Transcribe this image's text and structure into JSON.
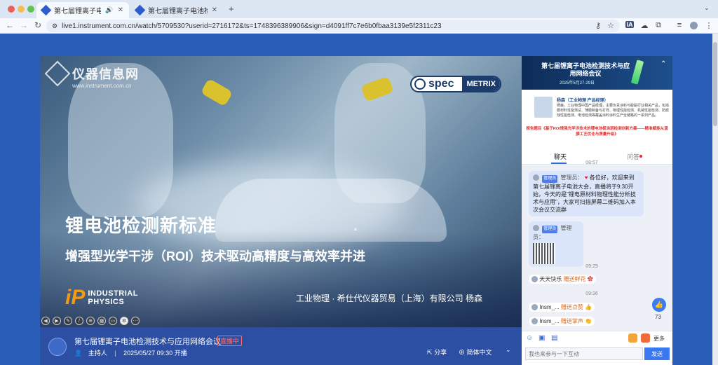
{
  "browser": {
    "tabs": [
      {
        "title": "第七届锂离子电池检测技术"
      },
      {
        "title": "第七届锂离子电池检测技术与应"
      }
    ],
    "new_tab": "+",
    "url": "live1.instrument.com.cn/watch/5709530?userid=2716172&ts=1748396389906&sign=d4091ff7c7e6b0fbaa3139e5f2311c23"
  },
  "slide": {
    "brand_logo": "仪器信息网",
    "brand_url": "www.instrument.com.cn",
    "spec_logo": {
      "left": "spec",
      "right": "METRIX"
    },
    "title": "锂电池检测新标准",
    "subtitle": "增强型光学干涉（ROI）技术驱动高精度与高效率并进",
    "ip_logo": {
      "mark": "iP",
      "line1": "INDUSTRIAL",
      "line2": "PHYSICS"
    },
    "presenter": "工业物理 · 希仕代仪器贸易（上海）有限公司   杨森"
  },
  "info": {
    "title": "第七届锂离子电池检测技术与应用网络会议",
    "live_badge": "直播中",
    "host_label": "主持人",
    "datetime": "2025/05/27 09:30 开播",
    "share": "分享",
    "lang": "简体中文"
  },
  "side": {
    "banner_title": "第七届锂离子电池检测技术与应用网络会议",
    "banner_date": "2025年5月27-29日",
    "speaker_name": "杨森（工业物理 产品经理）",
    "speaker_bio": "杨森，工业物理中国产品经理，主要负责涂料与胶黏行业相关产品，包括膜材料性能测试、薄膜制备与打样、物理性能检测、机械性能检测、防腐蚀性能检测、电池检测等覆盖涂料涂料生产全链路的一系列产品。",
    "speaker_topic": "报告题目《基于ROI增强光学涉技术的锂电池极涂层检测创新方案——精准赋能从湿膜工艺优化与质量升级》",
    "tab_chat": "聊天",
    "tab_qa": "问答",
    "messages": {
      "t1": "08:57",
      "admin_badge": "管理员",
      "admin_label": "管理员：",
      "m1": "各位好，欢迎来到第七届锂离子电池大会，直播将于9:30开始，今天的是\"锂电原材料物理性能分析技术与应用\"，大家可扫描屏幕二维码加入本次会议交流群",
      "t2": "09:29",
      "gift1_user": "天天快乐",
      "gift1_text": "赠送鲜花",
      "t3": "09:36",
      "gift2_user": "Insm_...",
      "gift2_text": "赠送点赞",
      "gift3_user": "Insm_...",
      "gift3_text": "赠送掌声"
    },
    "likes": "73",
    "more": "更多",
    "input_placeholder": "我也来参与一下互动",
    "send": "发送"
  }
}
